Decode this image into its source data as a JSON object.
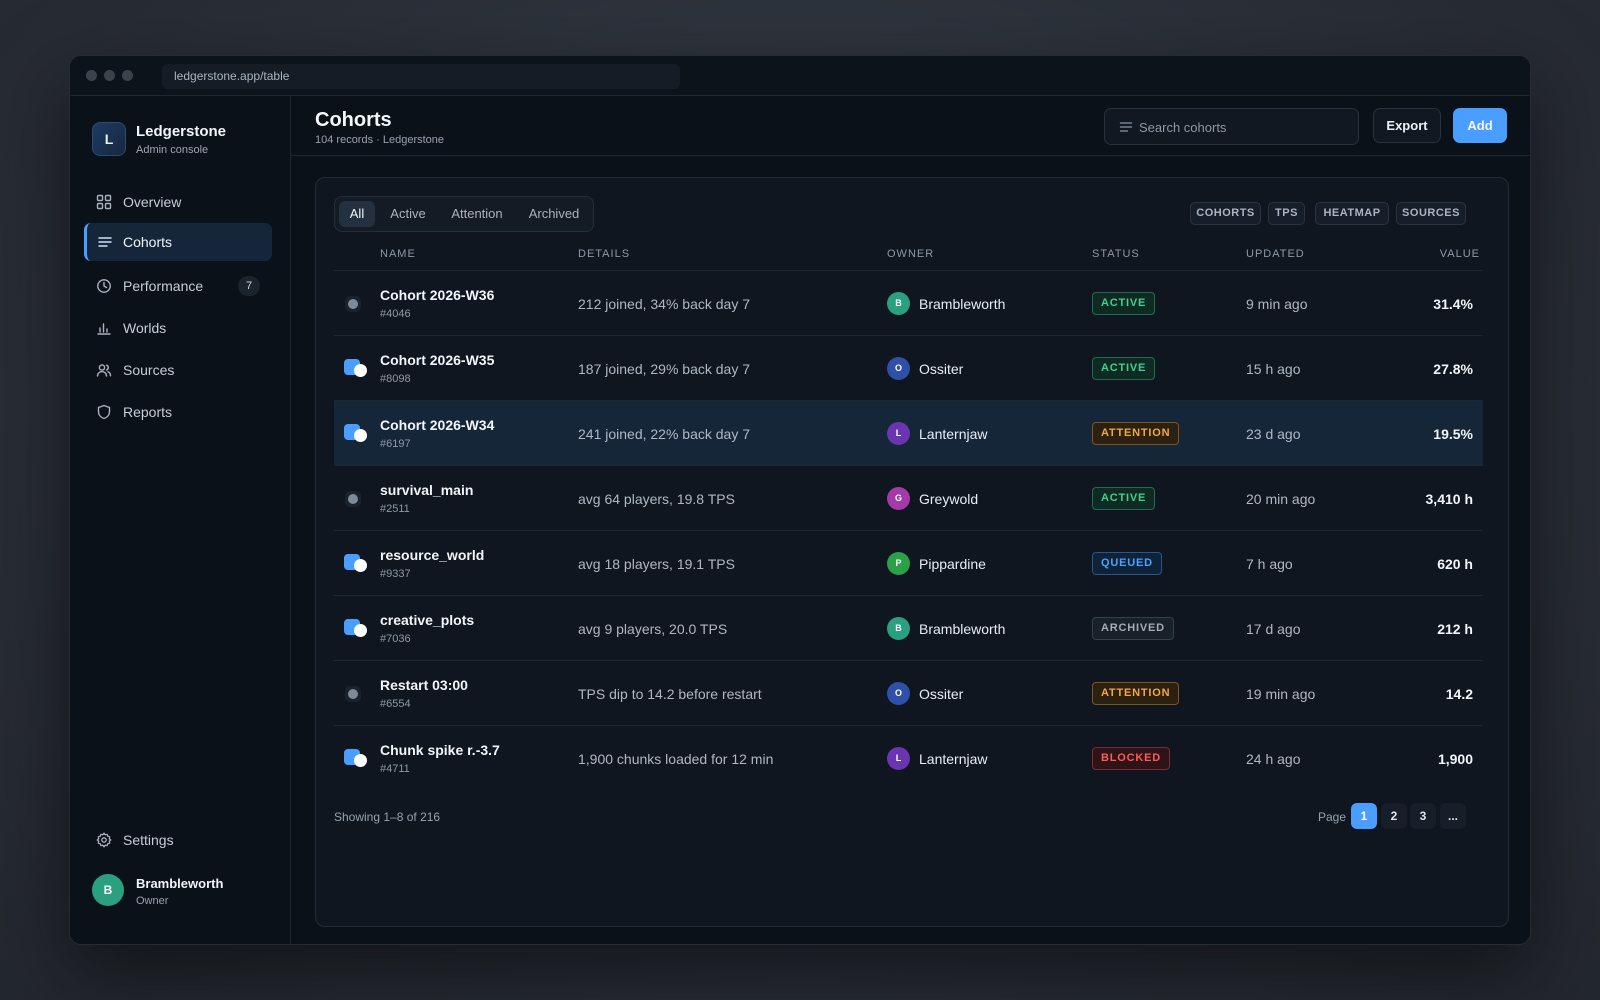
{
  "browser": {
    "url": "ledgerstone.app/table"
  },
  "brand": {
    "logo_letter": "L",
    "name": "Ledgerstone",
    "subtitle": "Admin console"
  },
  "sidebar": {
    "items": [
      {
        "label": "Overview",
        "icon": "grid-icon"
      },
      {
        "label": "Cohorts",
        "icon": "list-icon",
        "active": true
      },
      {
        "label": "Performance",
        "icon": "clock-icon",
        "badge": "7"
      },
      {
        "label": "Worlds",
        "icon": "bar-chart-icon"
      },
      {
        "label": "Sources",
        "icon": "users-icon"
      },
      {
        "label": "Reports",
        "icon": "shield-icon"
      }
    ],
    "settings_label": "Settings"
  },
  "user": {
    "initial": "B",
    "name": "Brambleworth",
    "role": "Owner"
  },
  "header": {
    "title": "Cohorts",
    "subtitle": "104 records · Ledgerstone",
    "search_placeholder": "Search cohorts",
    "export_label": "Export",
    "add_label": "Add"
  },
  "filters": {
    "tabs": [
      "All",
      "Active",
      "Attention",
      "Archived"
    ],
    "active_tab": "All"
  },
  "chips": [
    "COHORTS",
    "TPS",
    "HEATMAP",
    "SOURCES"
  ],
  "table": {
    "columns": [
      "NAME",
      "DETAILS",
      "OWNER",
      "STATUS",
      "UPDATED",
      "VALUE"
    ],
    "rows": [
      {
        "name": "Cohort 2026-W36",
        "id": "#4046",
        "details": "212 joined, 34% back day 7",
        "owner_initial": "B",
        "owner": "Brambleworth",
        "status": "ACTIVE",
        "updated": "9 min ago",
        "value": "31.4%",
        "checked": false,
        "selected": false
      },
      {
        "name": "Cohort 2026-W35",
        "id": "#8098",
        "details": "187 joined, 29% back day 7",
        "owner_initial": "O",
        "owner": "Ossiter",
        "status": "ACTIVE",
        "updated": "15 h ago",
        "value": "27.8%",
        "checked": true,
        "selected": false
      },
      {
        "name": "Cohort 2026-W34",
        "id": "#6197",
        "details": "241 joined, 22% back day 7",
        "owner_initial": "L",
        "owner": "Lanternjaw",
        "status": "ATTENTION",
        "updated": "23 d ago",
        "value": "19.5%",
        "checked": true,
        "selected": true
      },
      {
        "name": "survival_main",
        "id": "#2511",
        "details": "avg 64 players, 19.8 TPS",
        "owner_initial": "G",
        "owner": "Greywold",
        "status": "ACTIVE",
        "updated": "20 min ago",
        "value": "3,410 h",
        "checked": false,
        "selected": false
      },
      {
        "name": "resource_world",
        "id": "#9337",
        "details": "avg 18 players, 19.1 TPS",
        "owner_initial": "P",
        "owner": "Pippardine",
        "status": "QUEUED",
        "updated": "7 h ago",
        "value": "620 h",
        "checked": true,
        "selected": false
      },
      {
        "name": "creative_plots",
        "id": "#7036",
        "details": "avg 9 players, 20.0 TPS",
        "owner_initial": "B",
        "owner": "Brambleworth",
        "status": "ARCHIVED",
        "updated": "17 d ago",
        "value": "212 h",
        "checked": true,
        "selected": false
      },
      {
        "name": "Restart 03:00",
        "id": "#6554",
        "details": "TPS dip to 14.2 before restart",
        "owner_initial": "O",
        "owner": "Ossiter",
        "status": "ATTENTION",
        "updated": "19 min ago",
        "value": "14.2",
        "checked": false,
        "selected": false
      },
      {
        "name": "Chunk spike r.-3.7",
        "id": "#4711",
        "details": "1,900 chunks loaded for 12 min",
        "owner_initial": "L",
        "owner": "Lanternjaw",
        "status": "BLOCKED",
        "updated": "24 h ago",
        "value": "1,900",
        "checked": true,
        "selected": false
      }
    ]
  },
  "footer": {
    "showing": "Showing 1–8 of 216",
    "page_label": "Page",
    "pages": [
      "1",
      "2",
      "3",
      "..."
    ],
    "current_page": "1"
  },
  "colors": {
    "accent": "#4a9eff",
    "avatar": {
      "B": "#2aa080",
      "O": "#2f4fa8",
      "L": "#6a35b0",
      "G": "#a33aa8",
      "P": "#2aa048"
    },
    "status": {
      "ACTIVE": {
        "fg": "#3fd18f",
        "bg": "#0f2a22",
        "border": "#1f6b4e"
      },
      "ATTENTION": {
        "fg": "#f2a93b",
        "bg": "#2c2110",
        "border": "#7a5620"
      },
      "QUEUED": {
        "fg": "#4aa3ff",
        "bg": "#0f2238",
        "border": "#24568f"
      },
      "ARCHIVED": {
        "fg": "#a3adb9",
        "bg": "#18202a",
        "border": "#36404d"
      },
      "BLOCKED": {
        "fg": "#ff5a5a",
        "bg": "#2e1417",
        "border": "#7d2a30"
      }
    }
  }
}
